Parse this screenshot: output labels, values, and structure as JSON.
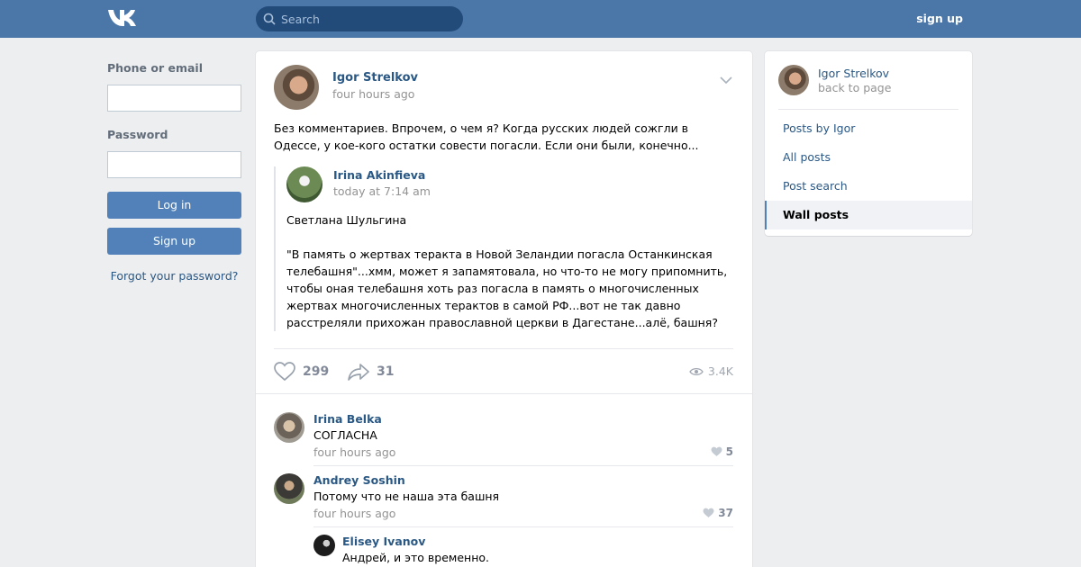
{
  "header": {
    "search_placeholder": "Search",
    "signup_label": "sign up"
  },
  "login": {
    "phone_label": "Phone or email",
    "password_label": "Password",
    "login_button": "Log in",
    "signup_button": "Sign up",
    "forgot_link": "Forgot your password?"
  },
  "post": {
    "author": "Igor Strelkov",
    "date": "four hours ago",
    "text": "Без комментариев. Впрочем, о чем я? Когда русских людей сожгли в Одессе, у кое-кого остатки совести погасли. Если они были, конечно...",
    "repost": {
      "author": "Irina Akinfieva",
      "date": "today at 7:14 am",
      "text": "Светлана Шульгина\n\n\"В память о жертвах теракта в Новой Зеландии погасла Останкинская телебашня\"...хмм, может я запамятовала, но что-то не могу припомнить, чтобы оная телебашня хоть раз погасла в память о многочисленных жертвах многочисленных терактов в самой РФ...вот не так давно расстреляли прихожан православной церкви в Дагестане...алё, башня?"
    },
    "likes": "299",
    "shares": "31",
    "views": "3.4K"
  },
  "comments": [
    {
      "name": "Irina Belka",
      "text": "СОГЛАСНА",
      "date": "four hours ago",
      "likes": "5"
    },
    {
      "name": "Andrey Soshin",
      "text": "Потому что не наша эта башня",
      "date": "four hours ago",
      "likes": "37"
    },
    {
      "name": "Elisey Ivanov",
      "text": "Андрей, и это временно."
    }
  ],
  "sidebar": {
    "name": "Igor Strelkov",
    "back": "back to page",
    "items": [
      {
        "label": "Posts by Igor"
      },
      {
        "label": "All posts"
      },
      {
        "label": "Post search"
      },
      {
        "label": "Wall posts"
      }
    ]
  },
  "colors": {
    "header": "#4a76a8",
    "button": "#5181b8",
    "link": "#2a5885",
    "background": "#edeef0"
  }
}
